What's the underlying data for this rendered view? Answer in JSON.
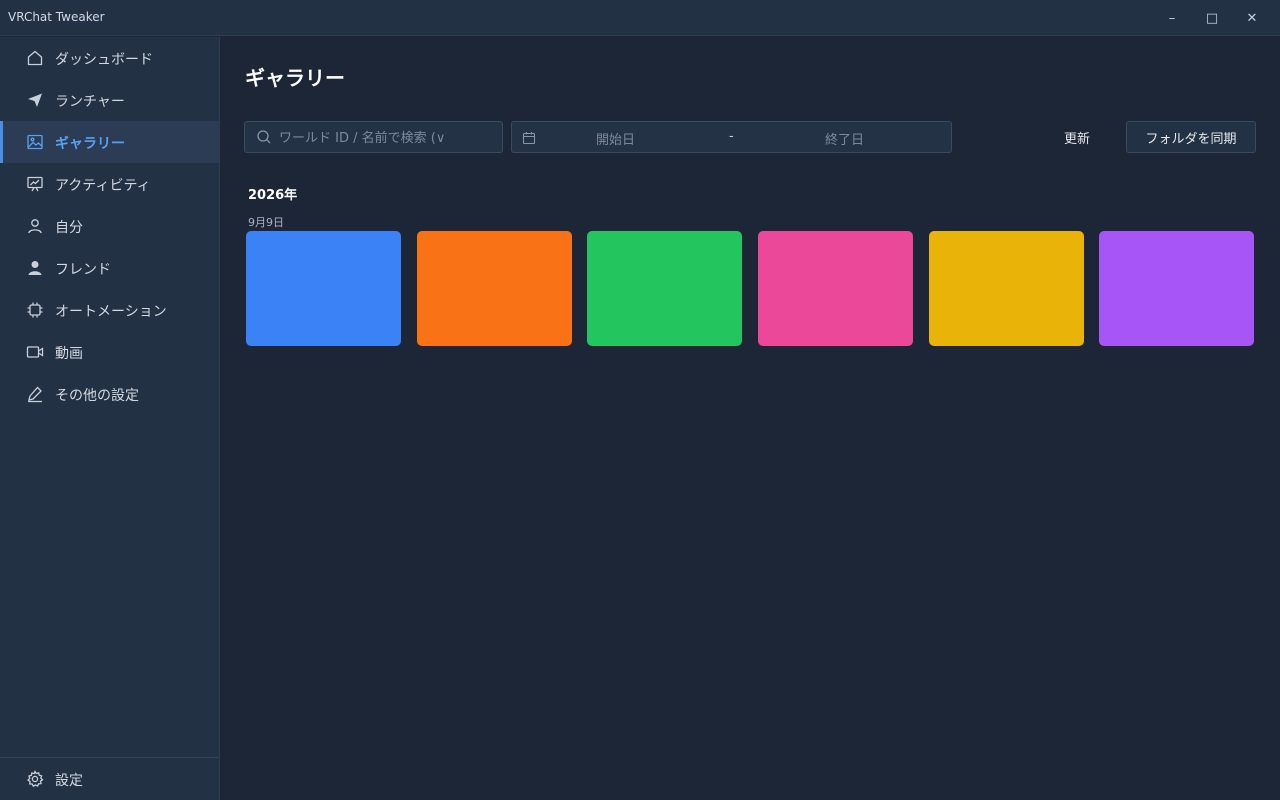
{
  "window": {
    "title": "VRChat Tweaker",
    "controls": {
      "minimize": "–",
      "maximize": "□",
      "close": "✕"
    }
  },
  "sidebar": {
    "items": [
      {
        "label": "ダッシュボード",
        "icon": "home-icon",
        "active": false
      },
      {
        "label": "ランチャー",
        "icon": "send-icon",
        "active": false
      },
      {
        "label": "ギャラリー",
        "icon": "image-icon",
        "active": true
      },
      {
        "label": "アクティビティ",
        "icon": "activity-chart-icon",
        "active": false
      },
      {
        "label": "自分",
        "icon": "user-icon",
        "active": false
      },
      {
        "label": "フレンド",
        "icon": "friend-icon",
        "active": false
      },
      {
        "label": "オートメーション",
        "icon": "chip-icon",
        "active": false
      },
      {
        "label": "動画",
        "icon": "video-icon",
        "active": false
      },
      {
        "label": "その他の設定",
        "icon": "pencil-icon",
        "active": false
      }
    ],
    "footer": {
      "label": "設定",
      "icon": "gear-icon"
    }
  },
  "main": {
    "title": "ギャラリー",
    "search": {
      "placeholder": "ワールド ID / 名前で検索 (∨",
      "value": ""
    },
    "date_range": {
      "start_placeholder": "開始日",
      "separator": "-",
      "end_placeholder": "終了日"
    },
    "refresh_label": "更新",
    "sync_label": "フォルダを同期",
    "groups": [
      {
        "year": "2026年",
        "date": "9月9日",
        "thumbnails": [
          {
            "color": "#3b82f6"
          },
          {
            "color": "#f97316"
          },
          {
            "color": "#22c55e"
          },
          {
            "color": "#ec4899"
          },
          {
            "color": "#eab308"
          },
          {
            "color": "#a855f7"
          }
        ]
      }
    ]
  },
  "colors": {
    "accent": "#4a90e2",
    "background": "#1d2636",
    "sidebar": "#223144"
  }
}
